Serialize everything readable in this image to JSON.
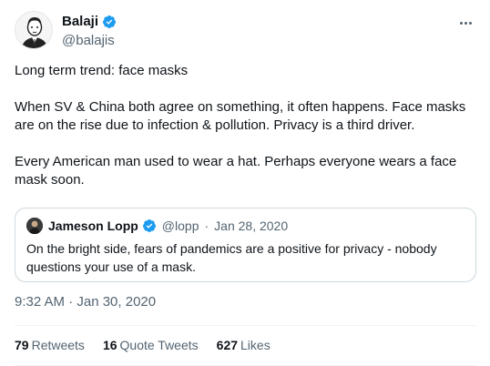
{
  "author": {
    "display_name": "Balaji",
    "handle": "@balajis",
    "verified_color": "#1d9bf0"
  },
  "tweet": {
    "paragraphs": [
      "Long term trend: face masks",
      "When SV & China both agree on something, it often happens. Face masks are on the rise due to infection & pollution. Privacy is a third driver.",
      "Every American man used to wear a hat. Perhaps everyone wears a face mask soon."
    ]
  },
  "quote": {
    "display_name": "Jameson Lopp",
    "handle": "@lopp",
    "separator": "·",
    "date": "Jan 28, 2020",
    "text": "On the bright side, fears of pandemics are a positive for privacy - nobody questions your use of a mask."
  },
  "timestamp": "9:32 AM · Jan 30, 2020",
  "stats": {
    "retweets": {
      "count": "79",
      "label": "Retweets"
    },
    "quote_tweets": {
      "count": "16",
      "label": "Quote Tweets"
    },
    "likes": {
      "count": "627",
      "label": "Likes"
    }
  },
  "icons": {
    "more": "more-icon",
    "verified": "verified-badge-icon"
  }
}
